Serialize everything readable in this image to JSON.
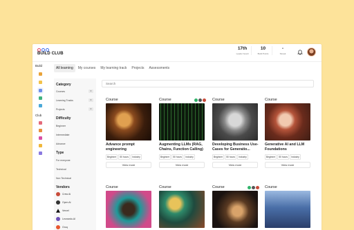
{
  "brand": {
    "name": "BUILD CLUB"
  },
  "stats": [
    {
      "value": "17th",
      "label": "Leader board"
    },
    {
      "value": "10",
      "label": "Build Points"
    },
    {
      "value": "-",
      "label": "Streak"
    }
  ],
  "rail": {
    "build_label": "Build",
    "club_label": "Club"
  },
  "tabs": [
    "All learning",
    "My courses",
    "My learning track",
    "Projects",
    "Assessments"
  ],
  "search": {
    "placeholder": "Search"
  },
  "filters": {
    "category": {
      "heading": "Category",
      "items": [
        {
          "label": "Courses",
          "count": "0"
        },
        {
          "label": "Learning Tracks",
          "count": "0"
        },
        {
          "label": "Projects",
          "count": "0"
        }
      ]
    },
    "difficulty": {
      "heading": "Difficulty",
      "items": [
        "Beginner",
        "Intermediate",
        "Advance"
      ]
    },
    "type": {
      "heading": "Type",
      "items": [
        "For everyone",
        "Technical",
        "Non Technical"
      ]
    },
    "vendors": {
      "heading": "Vendors",
      "items": [
        "Crew Ai",
        "Open Ai",
        "Vercel",
        "Leonardo.AI",
        "Groq"
      ]
    }
  },
  "cards": [
    {
      "type": "Course",
      "title": "Advance prompt engineering",
      "tags": [
        "Beginner",
        "50 hours",
        "Industry"
      ],
      "more": "View more"
    },
    {
      "type": "Course",
      "title": "Augmenting LLMs (RAG, Chains, Function Calling)",
      "tags": [
        "Beginner",
        "50 hours",
        "Industry"
      ],
      "more": "View more"
    },
    {
      "type": "Course",
      "title": "Developing Business Use-Cases for Generatio...",
      "tags": [
        "Beginner",
        "50 hours",
        "Industry"
      ],
      "more": "View more"
    },
    {
      "type": "Course",
      "title": "Generative AI and LLM Foundations",
      "tags": [
        "Beginner",
        "50 hours",
        "Industry"
      ],
      "more": "View more"
    },
    {
      "type": "Course"
    },
    {
      "type": "Course"
    },
    {
      "type": "Course"
    },
    {
      "type": "Course"
    }
  ],
  "colors": {
    "background": "#fde39a",
    "accent_pink": "#e8405f",
    "accent_blue": "#3d6bea"
  }
}
